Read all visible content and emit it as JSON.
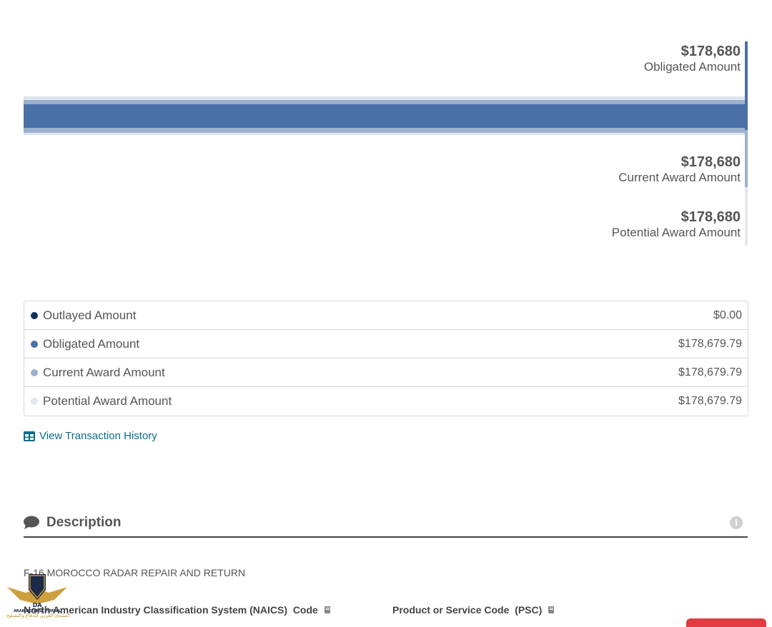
{
  "amounts": {
    "obligated": {
      "value": "$178,680",
      "label": "Obligated Amount"
    },
    "current": {
      "value": "$178,680",
      "label": "Current Award Amount"
    },
    "potential": {
      "value": "$178,680",
      "label": "Potential Award Amount"
    },
    "obligated_fraction": 1.0
  },
  "legend": [
    {
      "label": "Outlayed Amount",
      "value": "$0.00",
      "color": "#14305a"
    },
    {
      "label": "Obligated Amount",
      "value": "$178,679.79",
      "color": "#4a70a8"
    },
    {
      "label": "Current Award Amount",
      "value": "$178,679.79",
      "color": "#9bb0cc"
    },
    {
      "label": "Potential Award Amount",
      "value": "$178,679.79",
      "color": "#dfe6ef"
    }
  ],
  "history_link": "View Transaction History",
  "description": {
    "title": "Description",
    "text": "F-16 MOROCCO RADAR REPAIR AND RETURN",
    "naics_heading": "North American Industry Classification System (NAICS)  Code",
    "psc_heading": "Product or Service Code  (PSC)"
  },
  "colors": {
    "accent_link": "#0a6d8a",
    "bar_obligated": "#4a70a8",
    "bar_current": "#9bb0cc",
    "bar_potential": "#dfe6ef",
    "alert_red": "#e03c41"
  },
  "icons": {
    "history": "table-icon",
    "description": "comment-icon",
    "info": "info-icon",
    "glossary": "book-icon"
  },
  "watermark": {
    "brand": "DA",
    "line1": "ARAB DEFENSE PORTAL",
    "line2": "المنتدى العربي للدفاع والتسليح"
  }
}
